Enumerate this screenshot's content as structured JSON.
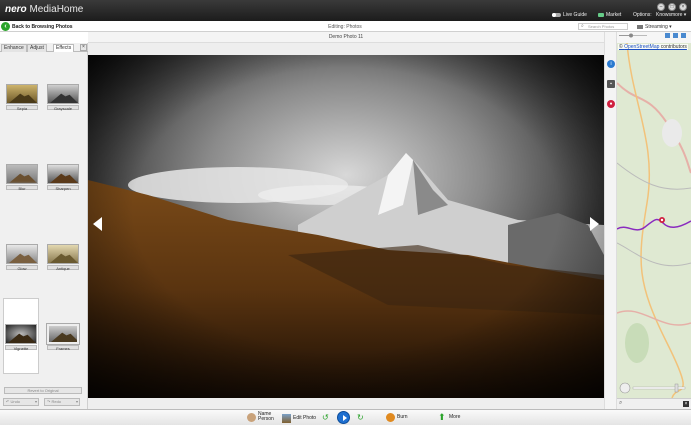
{
  "app": {
    "brand": "nero",
    "name": "MediaHome"
  },
  "titlebar": {
    "live_guide": "Live Guide",
    "market": "Market",
    "options": "Options:",
    "user": "Knowsmore ▾"
  },
  "navbar": {
    "back_label": "Back to Browsing Photos",
    "editing_label": "Editing: Photos",
    "search_placeholder": "Search Photos",
    "streaming": "Streaming ▾"
  },
  "photo": {
    "title": "Demo Photo 11"
  },
  "left_panel": {
    "tabs": [
      "Enhance",
      "Adjust",
      "Effects"
    ],
    "close": "×",
    "effects": [
      "Sepia",
      "Grayscale",
      "Blur",
      "Sharpen",
      "Glow",
      "Antique",
      "Vignette",
      "Frames"
    ],
    "revert_label": "Revert to Original",
    "undo_label": "Undo",
    "redo_label": "Redo"
  },
  "map": {
    "attribution_link": "OpenStreetMap",
    "attribution_rest": " contributors"
  },
  "bottombar": {
    "name_person": "Name Person",
    "edit_photo": "Edit Photo",
    "burn": "Burn",
    "more": "More"
  },
  "colors": {
    "accent_green": "#2aa32a",
    "play_blue": "#1e6fd0",
    "map_route": "#8a2bbf",
    "map_pin": "#d02040"
  }
}
